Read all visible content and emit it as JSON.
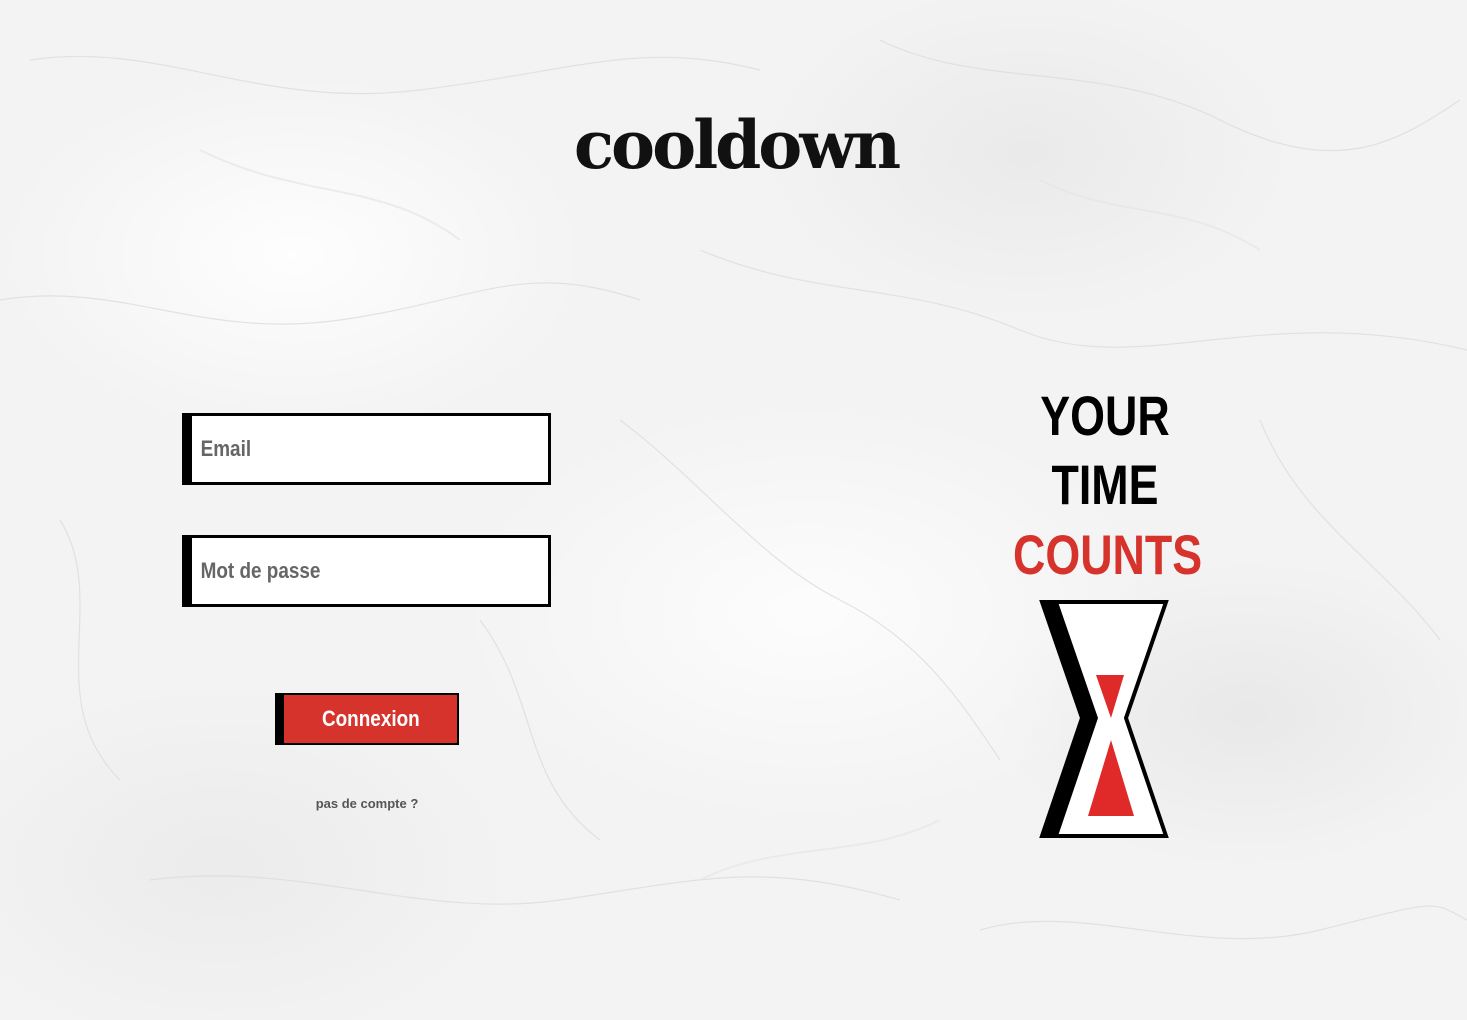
{
  "brand": {
    "logo_text": "cooldown"
  },
  "login_form": {
    "email_placeholder": "Email",
    "password_placeholder": "Mot de passe",
    "submit_label": "Connexion",
    "signup_link": "pas de compte ?"
  },
  "slogan": {
    "line1": "YOUR",
    "line2": "TIME",
    "line3": "COUNTS"
  },
  "colors": {
    "accent": "#d6332d",
    "ink": "#000000",
    "background": "#f2f2f2"
  },
  "icons": {
    "hourglass": "hourglass-icon"
  }
}
